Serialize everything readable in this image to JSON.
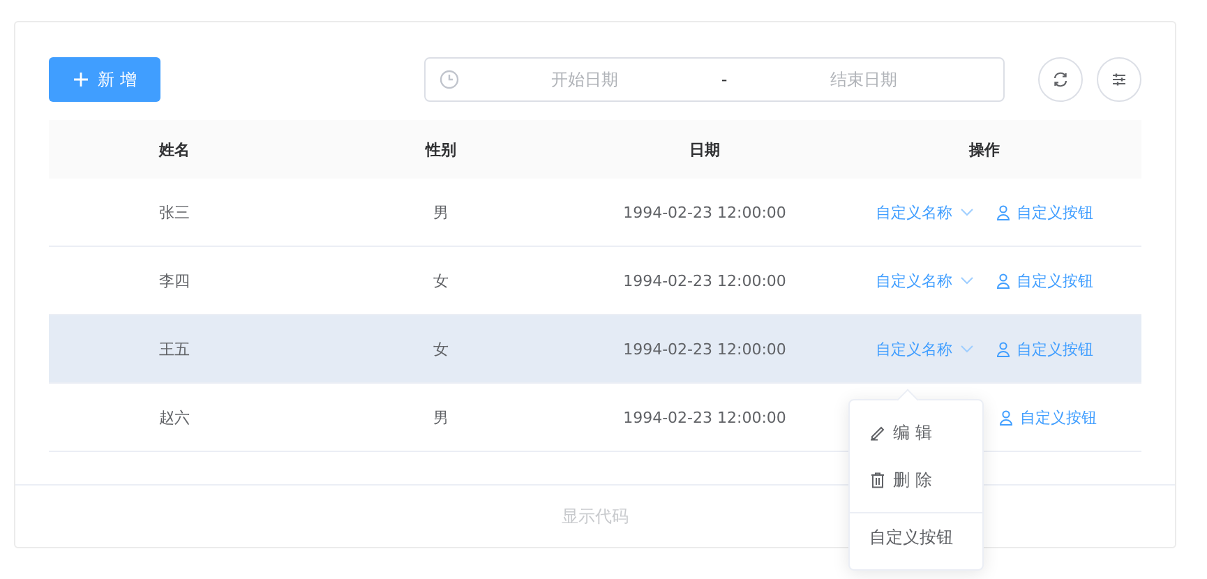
{
  "toolbar": {
    "add_button": "新 增",
    "date_range": {
      "start_placeholder": "开始日期",
      "separator": "-",
      "end_placeholder": "结束日期"
    }
  },
  "table": {
    "columns": [
      "姓名",
      "性别",
      "日期",
      "操作"
    ],
    "rows": [
      {
        "name": "张三",
        "gender": "男",
        "date": "1994-02-23 12:00:00",
        "dropdown_label": "自定义名称",
        "button_label": "自定义按钮",
        "hovered": false
      },
      {
        "name": "李四",
        "gender": "女",
        "date": "1994-02-23 12:00:00",
        "dropdown_label": "自定义名称",
        "button_label": "自定义按钮",
        "hovered": false
      },
      {
        "name": "王五",
        "gender": "女",
        "date": "1994-02-23 12:00:00",
        "dropdown_label": "自定义名称",
        "button_label": "自定义按钮",
        "hovered": true
      },
      {
        "name": "赵六",
        "gender": "男",
        "date": "1994-02-23 12:00:00",
        "button_label": "自定义按钮",
        "hovered": false
      }
    ]
  },
  "dropdown_menu": {
    "open": true,
    "items": [
      {
        "label": "编 辑",
        "kind": "edit",
        "divided": false
      },
      {
        "label": "删 除",
        "kind": "delete",
        "divided": false
      },
      {
        "label": "自定义按钮",
        "kind": "plain",
        "divided": true
      }
    ]
  },
  "footer": {
    "label": "显示代码"
  }
}
